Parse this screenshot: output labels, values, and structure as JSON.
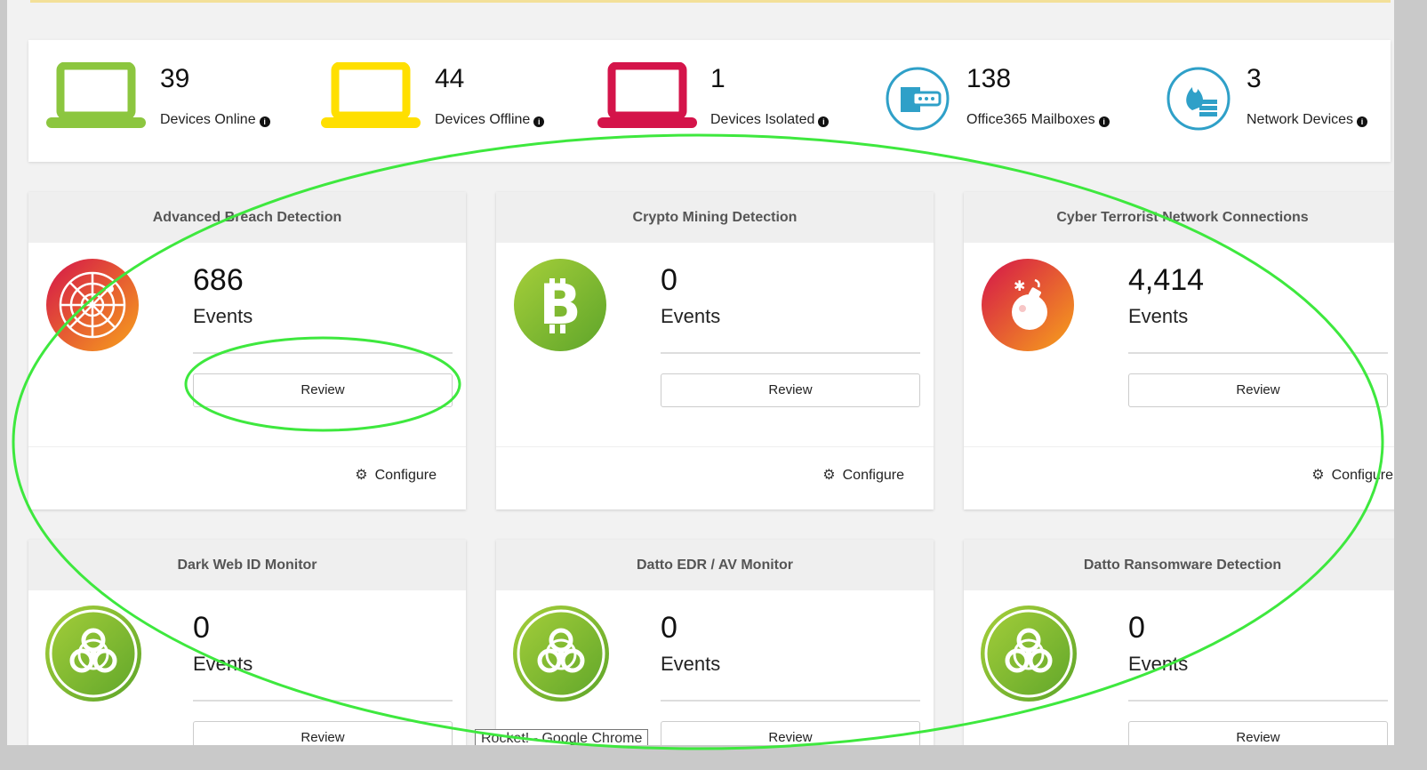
{
  "summary": {
    "devices_online": {
      "count": "39",
      "label": "Devices Online",
      "color": "#8cc63f"
    },
    "devices_offline": {
      "count": "44",
      "label": "Devices Offline",
      "color": "#ffdf00"
    },
    "devices_isolated": {
      "count": "1",
      "label": "Devices Isolated",
      "color": "#d4144a"
    },
    "office365_mailboxes": {
      "count": "138",
      "label": "Office365 Mailboxes",
      "color": "#2fa0c8"
    },
    "network_devices": {
      "count": "3",
      "label": "Network Devices",
      "color": "#2fa0c8"
    }
  },
  "cards": [
    {
      "title": "Advanced Breach Detection",
      "count": "686",
      "unit": "Events",
      "review": "Review",
      "configure": "Configure",
      "icon": "radar-icon"
    },
    {
      "title": "Crypto Mining Detection",
      "count": "0",
      "unit": "Events",
      "review": "Review",
      "configure": "Configure",
      "icon": "bitcoin-icon"
    },
    {
      "title": "Cyber Terrorist Network Connections",
      "count": "4,414",
      "unit": "Events",
      "review": "Review",
      "configure": "Configure",
      "icon": "bomb-icon"
    },
    {
      "title": "Dark Web ID Monitor",
      "count": "0",
      "unit": "Events",
      "review": "Review",
      "icon": "biohazard-icon"
    },
    {
      "title": "Datto EDR / AV Monitor",
      "count": "0",
      "unit": "Events",
      "review": "Review",
      "icon": "biohazard-icon"
    },
    {
      "title": "Datto Ransomware Detection",
      "count": "0",
      "unit": "Events",
      "review": "Review",
      "icon": "biohazard-icon"
    }
  ],
  "tooltip": "Rocket! - Google Chrome",
  "colors": {
    "annotation": "#3ee83e",
    "green_icon": "#8cc63f",
    "red_icon": "#d4144a"
  }
}
